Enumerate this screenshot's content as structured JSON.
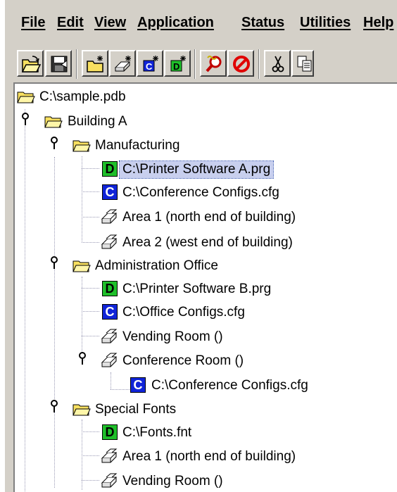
{
  "menubar": {
    "items": [
      {
        "label": "File"
      },
      {
        "label": "Edit"
      },
      {
        "label": "View"
      },
      {
        "label": "Application"
      },
      {
        "label": "Status"
      },
      {
        "label": "Utilities"
      },
      {
        "label": "Help"
      }
    ]
  },
  "toolbar": {
    "buttons": [
      {
        "icon": "open-folder-icon"
      },
      {
        "icon": "save-disk-icon"
      },
      {
        "icon": "new-folder-icon"
      },
      {
        "icon": "new-printer-icon"
      },
      {
        "icon": "new-config-icon"
      },
      {
        "icon": "new-download-icon"
      },
      {
        "icon": "find-icon"
      },
      {
        "icon": "stop-icon"
      },
      {
        "icon": "cut-icon"
      },
      {
        "icon": "copy-icon"
      }
    ]
  },
  "tree": {
    "root": "C:\\sample.pdb",
    "building_a": "Building A",
    "manufacturing": "Manufacturing",
    "mfg_printer_software": "C:\\Printer Software A.prg",
    "mfg_conference_configs": "C:\\Conference Configs.cfg",
    "mfg_area1": "Area 1 (north end of building)",
    "mfg_area2": "Area 2 (west end of building)",
    "admin_office": "Administration Office",
    "admin_printer_software": "C:\\Printer Software B.prg",
    "admin_office_configs": "C:\\Office Configs.cfg",
    "admin_vending_room": "Vending Room ()",
    "admin_conference_room": "Conference Room ()",
    "conf_room_configs": "C:\\Conference Configs.cfg",
    "special_fonts": "Special Fonts",
    "fonts_file": "C:\\Fonts.fnt",
    "fonts_area1": "Area 1 (north end of building)",
    "fonts_vending_room": "Vending Room ()",
    "badge_download": "D",
    "badge_config": "C"
  },
  "colors": {
    "selection": "#c8cfee",
    "download_badge": "#1fbf2a",
    "config_badge": "#1024d8",
    "folder": "#f8e060"
  }
}
